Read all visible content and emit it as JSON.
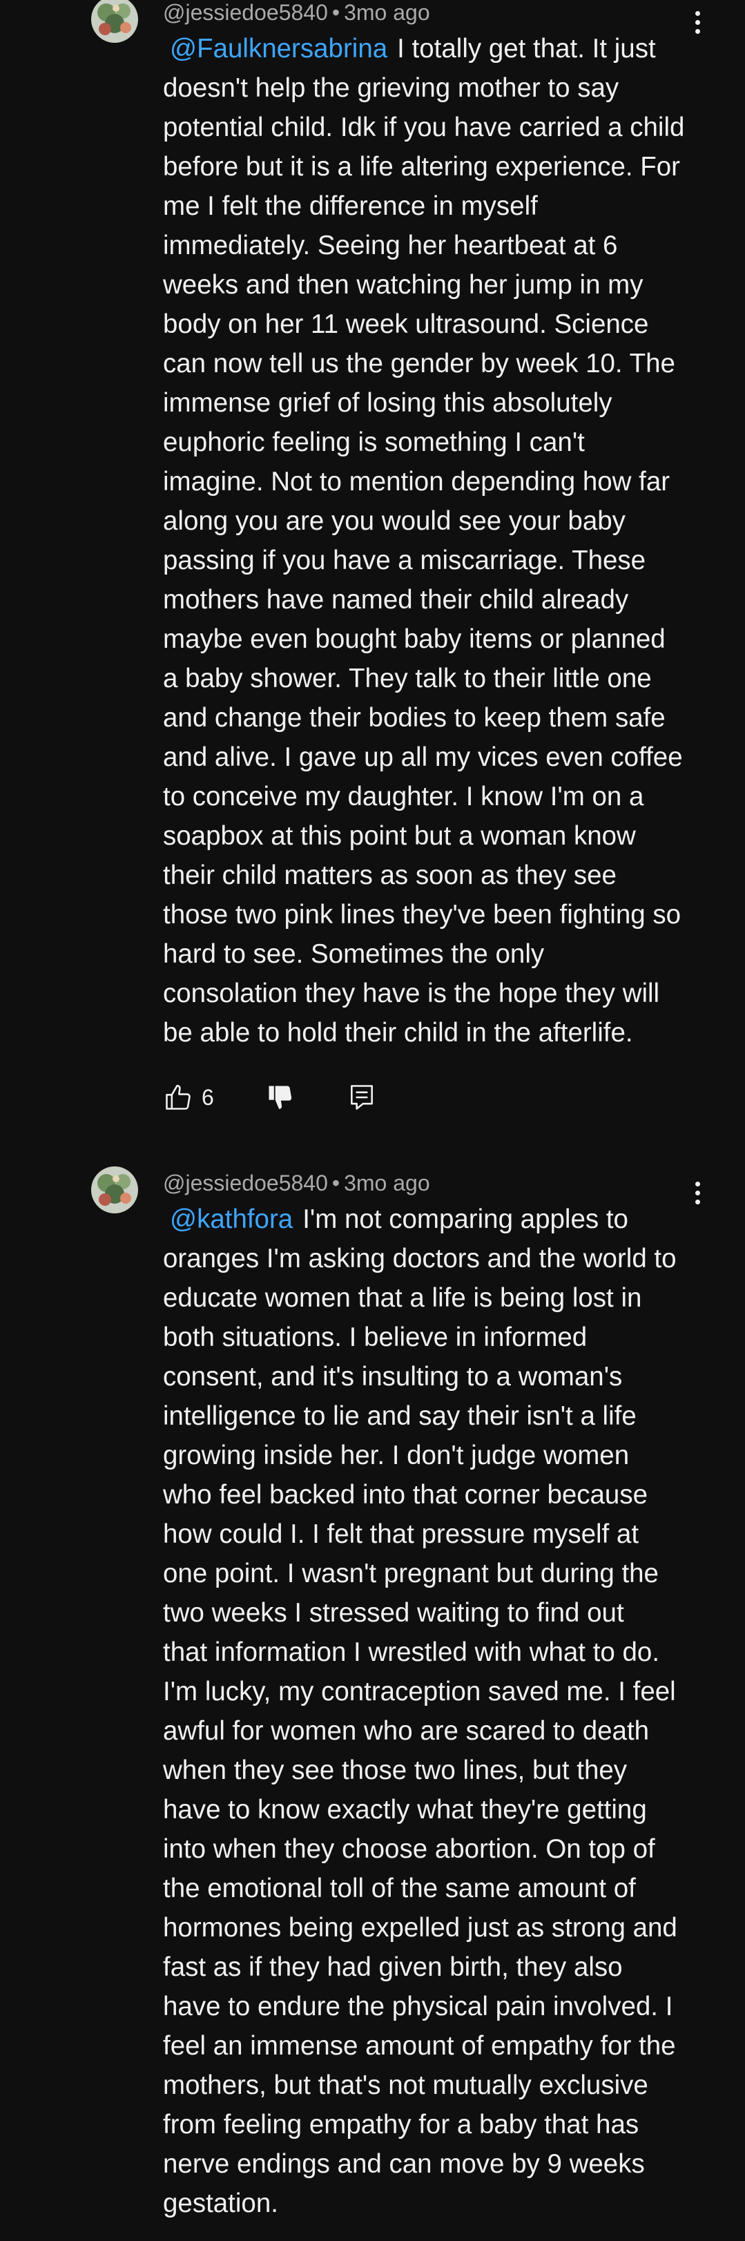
{
  "comments": [
    {
      "author": "@jessiedoe5840",
      "separator": "•",
      "time": "3mo ago",
      "mention": "@Faulknersabrina",
      "text": "I totally get that. It just\ndoesn't help the grieving mother to say\npotential child. Idk if you have carried a child\nbefore but it is a life altering experience. For\nme I felt the difference in myself\nimmediately. Seeing her heartbeat at 6\nweeks  and then watching her jump in my\nbody on her 11 week ultrasound. Science\ncan now tell us the gender by week 10. The\nimmense grief of losing this absolutely\neuphoric feeling is something I can't\nimagine. Not to mention depending how far\nalong you are you would see your baby\npassing if you have a miscarriage. These\nmothers have named their child already\nmaybe even bought baby items or planned\na baby shower. They talk to their little one\nand change their bodies to keep them safe\nand alive. I gave up all my vices even coffee\nto conceive my daughter. I know I'm on a\nsoapbox at this point but a woman know\ntheir child matters as soon as they see\nthose two pink lines they've been fighting so\nhard to see. Sometimes the only\nconsolation they have is the hope they will\nbe able to hold their child in the afterlife.",
      "likes": "6",
      "icons": {
        "like": "thumbs-up-icon",
        "dislike": "thumbs-down-icon",
        "reply": "reply-comment-icon",
        "more": "more-vert-icon"
      }
    },
    {
      "author": "@jessiedoe5840",
      "separator": "•",
      "time": "3mo ago",
      "mention": "@kathfora",
      "text": "I'm not comparing apples to\noranges I'm asking doctors and the world to\neducate women that a life is being lost in\nboth situations. I believe in informed\nconsent, and it's insulting to a woman's\nintelligence to lie and say their isn't a life\ngrowing inside her. I don't judge women\nwho feel backed into that corner because\nhow could I. I felt that pressure myself at\none point. I wasn't pregnant but during the\ntwo weeks I stressed waiting to find out\nthat information I wrestled with what to do.\nI'm lucky, my contraception saved me. I feel\nawful for women who are scared to death\nwhen they see those two lines, but they\nhave to know exactly what they're getting\ninto when they choose abortion. On top of\nthe emotional toll of the same amount of\nhormones being expelled just as strong and\nfast as if they had given birth, they also\nhave to endure the physical pain involved. I\nfeel an immense amount of empathy for the\nmothers, but that's not mutually exclusive\nfrom feeling empathy for a baby that has\nnerve endings and can move by 9 weeks\ngestation.",
      "icons": {
        "more": "more-vert-icon"
      }
    }
  ],
  "colors": {
    "background": "#0f0f0f",
    "text": "#f1f1f1",
    "secondary": "#aaaaaa",
    "mention": "#3ea6ff"
  }
}
